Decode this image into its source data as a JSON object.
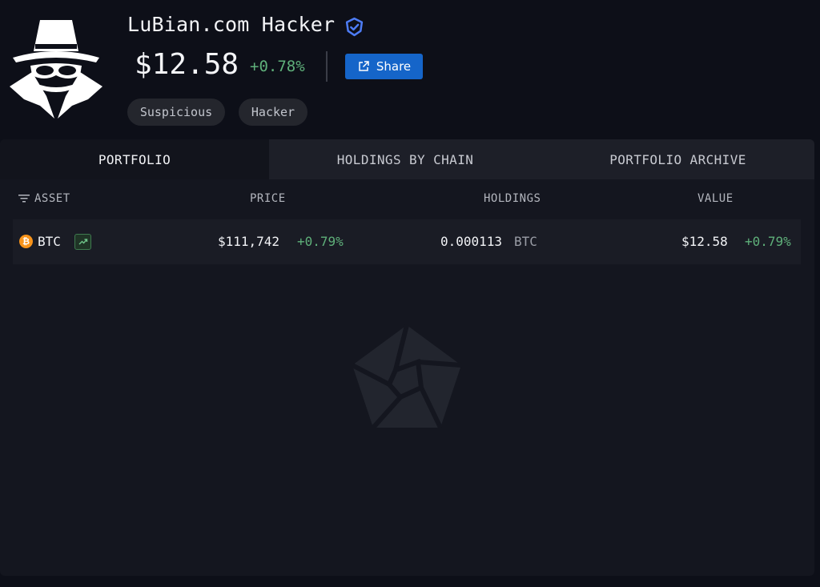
{
  "entity": {
    "name": "LuBian.com Hacker",
    "balance": "$12.58",
    "balance_change": "+0.78%",
    "share_label": "Share",
    "tags": [
      "Suspicious",
      "Hacker"
    ]
  },
  "tabs": [
    {
      "label": "PORTFOLIO",
      "active": true
    },
    {
      "label": "HOLDINGS BY CHAIN",
      "active": false
    },
    {
      "label": "PORTFOLIO ARCHIVE",
      "active": false
    }
  ],
  "table": {
    "columns": {
      "asset": "ASSET",
      "price": "PRICE",
      "holdings": "HOLDINGS",
      "value": "VALUE"
    },
    "rows": [
      {
        "asset": "BTC",
        "price": "$111,742",
        "price_change": "+0.79%",
        "holdings": "0.000113",
        "holdings_unit": "BTC",
        "value": "$12.58",
        "value_change": "+0.79%"
      }
    ]
  },
  "icons": {
    "avatar": "hacker-spy-icon",
    "verified": "verified-badge-icon",
    "share": "external-link-icon",
    "filter": "filter-icon",
    "asset": "bitcoin-icon",
    "trend": "trending-up-icon",
    "watermark": "arkham-logo-icon"
  },
  "colors": {
    "background": "#0d0f18",
    "panel": "#14161f",
    "positive": "#5fb07a",
    "accent": "#1565c9",
    "verified": "#4d7cf5",
    "bitcoin": "#f7931a"
  }
}
